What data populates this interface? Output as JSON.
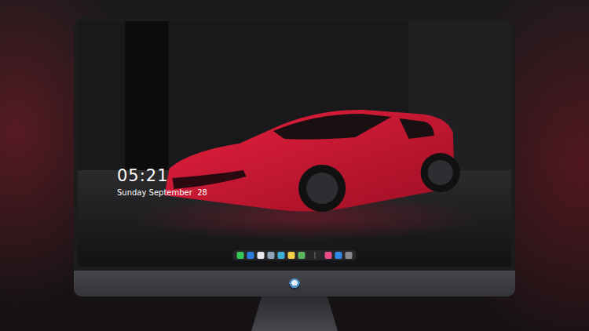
{
  "screen": {
    "clock": {
      "time": "05:21",
      "date": "Sunday September  28"
    }
  },
  "dock": {
    "groups": [
      {
        "items": [
          {
            "color": "#34c759"
          },
          {
            "color": "#2f7ce0"
          },
          {
            "color": "#e9e9ef"
          },
          {
            "color": "#8fa3b8"
          },
          {
            "color": "#3ab0d6"
          },
          {
            "color": "#f5cd47"
          },
          {
            "color": "#5cb85c"
          }
        ]
      },
      {
        "items": [
          {
            "color": "#e84a8a"
          },
          {
            "color": "#2e8ae6"
          },
          {
            "color": "#8a8a8e"
          }
        ]
      }
    ]
  }
}
